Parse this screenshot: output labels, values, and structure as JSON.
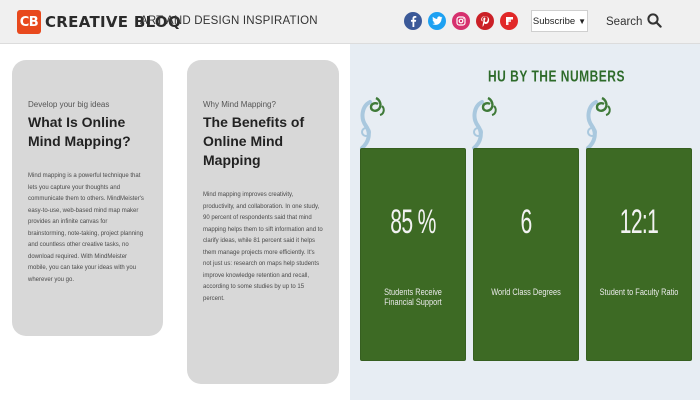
{
  "header": {
    "logo_badge": "CB",
    "logo_text": "CREATIVE BLOQ",
    "tagline": "ART AND DESIGN INSPIRATION",
    "socials": [
      {
        "name": "facebook",
        "glyph": "f",
        "color": "#3b5998"
      },
      {
        "name": "twitter",
        "glyph": "t",
        "color": "#1da1f2"
      },
      {
        "name": "instagram",
        "glyph": "ig",
        "color": "#d6306e"
      },
      {
        "name": "pinterest",
        "glyph": "p",
        "color": "#cb2027"
      },
      {
        "name": "flipboard",
        "glyph": "f",
        "color": "#e12828"
      }
    ],
    "subscribe_label": "Subscribe",
    "subscribe_caret": "▼",
    "search_label": "Search"
  },
  "cards": [
    {
      "kicker": "Develop your big ideas",
      "title": "What Is Online Mind Mapping?",
      "body": "Mind mapping is a powerful technique that lets you capture your thoughts and communicate them to others. MindMeister's easy-to-use, web-based mind map maker provides an infinite canvas for brainstorming, note-taking, project planning and countless other creative tasks, no download required. With MindMeister mobile, you can take your ideas with you wherever you go."
    },
    {
      "kicker": "Why Mind Mapping?",
      "title": "The Benefits of Online Mind Mapping",
      "body": "Mind mapping improves creativity, productivity, and collaboration. In one study, 90 percent of respondents said that mind mapping helps them to sift information and to clarify ideas, while 81 percent said it helps them manage projects more efficiently. It's not just us: research on maps help students improve knowledge retention and recall, according to some studies by up to 15 percent."
    }
  ],
  "numbers": {
    "title": "HU BY THE NUMBERS",
    "subtitle": "",
    "deco_icon": "leaf-swirl-icon",
    "stat_color": "#3d6a24",
    "stats": [
      {
        "value": "85 %",
        "label": "Students Receive Financial Support"
      },
      {
        "value": "6",
        "label": "World Class Degrees"
      },
      {
        "value": "12:1",
        "label": "Student to Faculty Ratio"
      }
    ]
  }
}
